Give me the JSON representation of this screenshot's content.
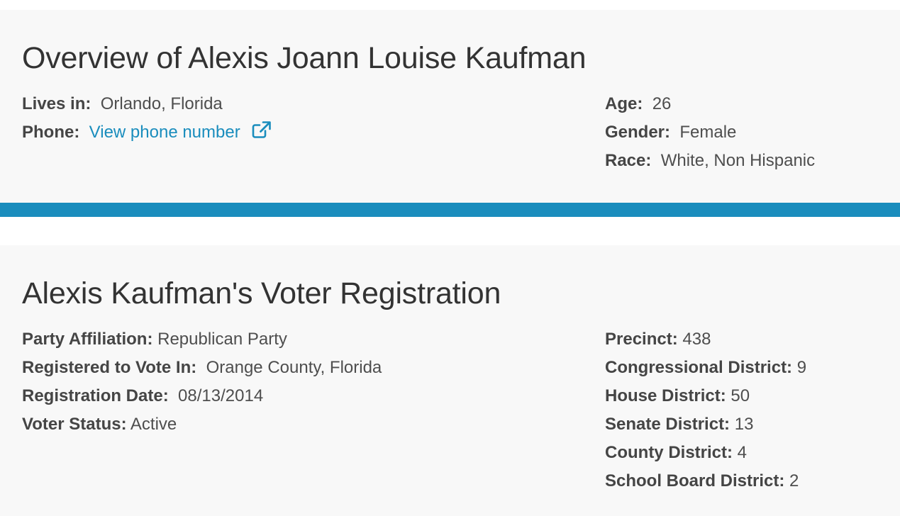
{
  "overview": {
    "title": "Overview of Alexis Joann Louise Kaufman",
    "lives_in_label": "Lives in:",
    "lives_in_value": "Orlando, Florida",
    "phone_label": "Phone:",
    "phone_link": "View phone number",
    "phone_icon": "external-link-icon",
    "age_label": "Age:",
    "age_value": "26",
    "gender_label": "Gender:",
    "gender_value": "Female",
    "race_label": "Race:",
    "race_value": "White, Non Hispanic"
  },
  "registration": {
    "title": "Alexis Kaufman's Voter Registration",
    "party_label": "Party Affiliation:",
    "party_value": "Republican Party",
    "registered_label": "Registered to Vote In:",
    "registered_value": "Orange County, Florida",
    "date_label": "Registration Date:",
    "date_value": "08/13/2014",
    "status_label": "Voter Status:",
    "status_value": "Active",
    "precinct_label": "Precinct:",
    "precinct_value": "438",
    "congressional_label": "Congressional District:",
    "congressional_value": "9",
    "house_label": "House District:",
    "house_value": "50",
    "senate_label": "Senate District:",
    "senate_value": "13",
    "county_label": "County District:",
    "county_value": "4",
    "school_label": "School Board District:",
    "school_value": "2"
  },
  "colors": {
    "accent": "#1a8dbd",
    "card_background": "#f8f8f8",
    "heading_text": "#333333",
    "body_text": "#4a4a4a"
  }
}
